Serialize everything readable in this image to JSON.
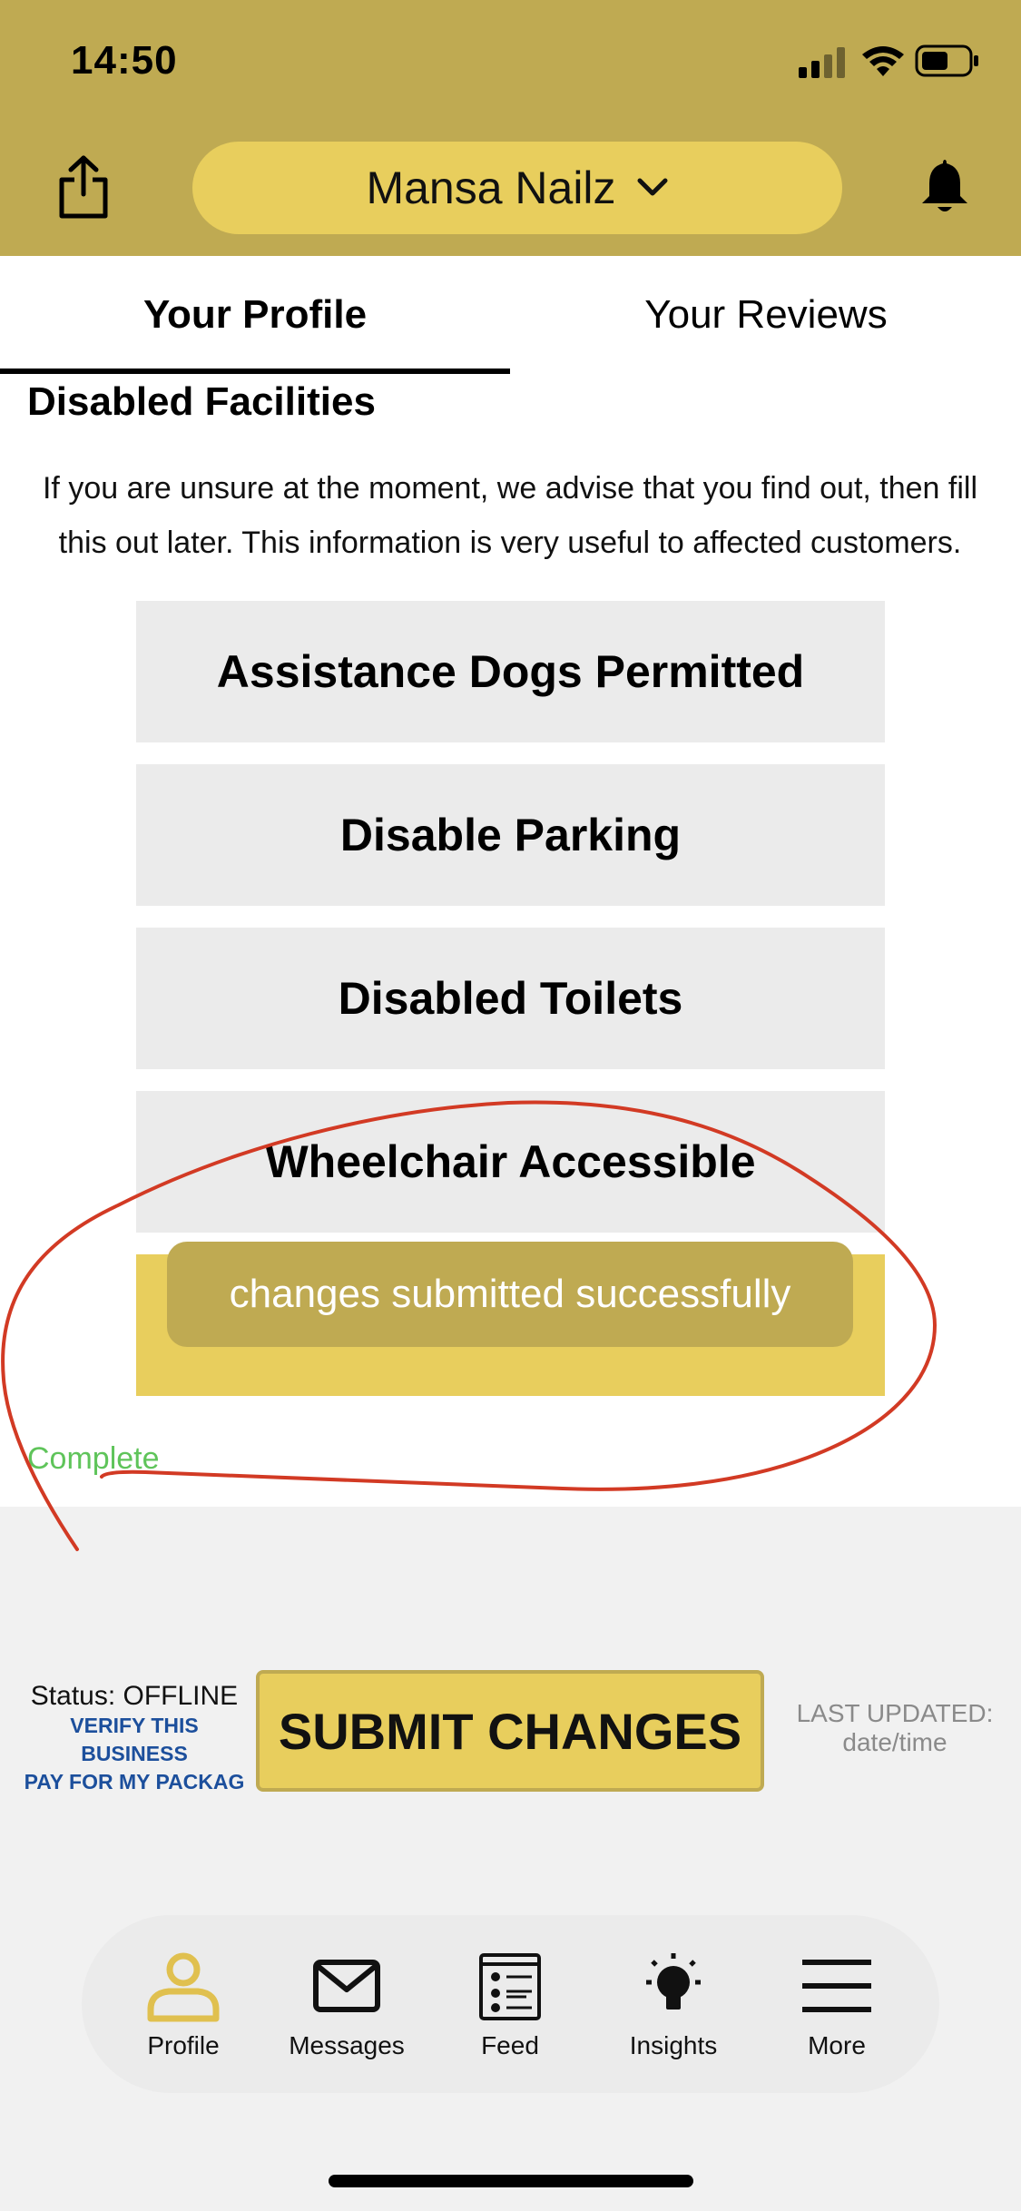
{
  "status_bar": {
    "time": "14:50"
  },
  "header": {
    "business_name": "Mansa Nailz",
    "share_icon": "share-icon",
    "bell_icon": "bell-icon",
    "background": "#bfaa52",
    "pill_color": "#e8ce5d"
  },
  "tabs": [
    {
      "label": "Your Profile",
      "active": true
    },
    {
      "label": "Your Reviews",
      "active": false
    }
  ],
  "section": {
    "title": "Disabled Facilities",
    "description": "If you are unsure at the moment, we advise that you find out, then fill this out later. This information is very useful to affected customers."
  },
  "options": [
    {
      "label": "Assistance Dogs Permitted"
    },
    {
      "label": "Disable Parking"
    },
    {
      "label": "Disabled Toilets"
    },
    {
      "label": "Wheelchair Accessible"
    }
  ],
  "toast": {
    "message": "changes submitted successfully"
  },
  "complete_label": "Complete",
  "footer": {
    "status": "Status: OFFLINE",
    "verify_link": "VERIFY THIS BUSINESS",
    "pay_link": "PAY FOR MY PACKAG",
    "submit_label": "SUBMIT CHANGES",
    "last_updated_label": "LAST UPDATED:",
    "last_updated_value": "date/time"
  },
  "nav": [
    {
      "label": "Profile",
      "icon": "profile-icon",
      "active": true
    },
    {
      "label": "Messages",
      "icon": "envelope-icon",
      "active": false
    },
    {
      "label": "Feed",
      "icon": "feed-icon",
      "active": false
    },
    {
      "label": "Insights",
      "icon": "lightbulb-icon",
      "active": false
    },
    {
      "label": "More",
      "icon": "menu-icon",
      "active": false
    }
  ],
  "colors": {
    "accent_yellow": "#e8ce5d",
    "accent_gold": "#bfaa52",
    "link_blue": "#1c4f9c",
    "complete_green": "#5fc45a",
    "annotation_red": "#d23a24"
  }
}
